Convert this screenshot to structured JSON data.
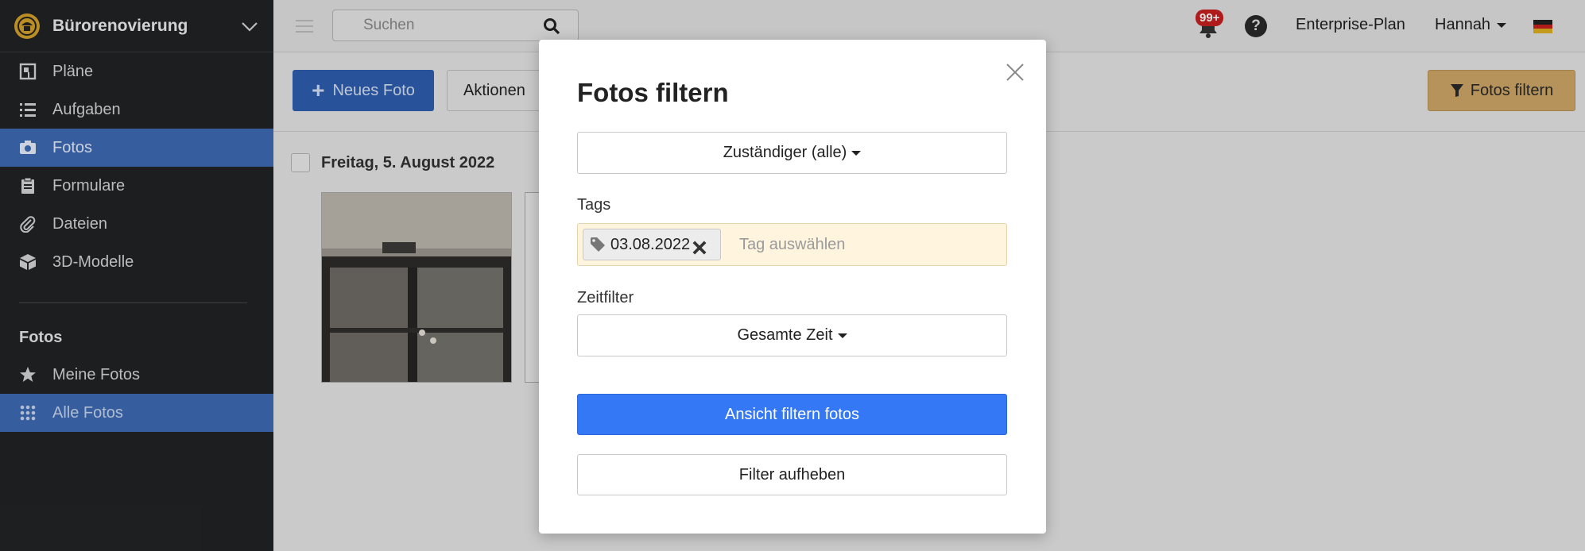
{
  "sidebar": {
    "project_name": "Bürorenovierung",
    "items": [
      {
        "label": "Pläne",
        "icon": "floorplan-icon"
      },
      {
        "label": "Aufgaben",
        "icon": "list-icon"
      },
      {
        "label": "Fotos",
        "icon": "camera-icon",
        "active": true
      },
      {
        "label": "Formulare",
        "icon": "clipboard-icon"
      },
      {
        "label": "Dateien",
        "icon": "paperclip-icon"
      },
      {
        "label": "3D-Modelle",
        "icon": "cube-icon"
      }
    ],
    "section_title": "Fotos",
    "sub_items": [
      {
        "label": "Meine Fotos",
        "icon": "star-icon"
      },
      {
        "label": "Alle Fotos",
        "icon": "grid-icon",
        "active": true
      }
    ]
  },
  "topbar": {
    "search_placeholder": "Suchen",
    "notification_count": "99+",
    "help_symbol": "?",
    "plan_label": "Enterprise-Plan",
    "user_name": "Hannah",
    "language": "de"
  },
  "toolbar": {
    "new_photo_label": "Neues Foto",
    "actions_label": "Aktionen",
    "filter_label": "Fotos filtern"
  },
  "content": {
    "date_group_label": "Freitag, 5. August 2022"
  },
  "modal": {
    "title": "Fotos filtern",
    "assignee_dropdown": "Zuständiger (alle)",
    "tags_label": "Tags",
    "selected_tag": "03.08.2022",
    "tag_placeholder": "Tag auswählen",
    "time_filter_label": "Zeitfilter",
    "time_filter_value": "Gesamte Zeit",
    "apply_button": "Ansicht filtern fotos",
    "reset_button": "Filter aufheben"
  },
  "colors": {
    "primary_blue": "#3478f6",
    "sidebar_active": "#3e6cb4",
    "filter_button": "#cfa868",
    "tag_field_bg": "#fff4de",
    "badge_red": "#c81e1e"
  }
}
